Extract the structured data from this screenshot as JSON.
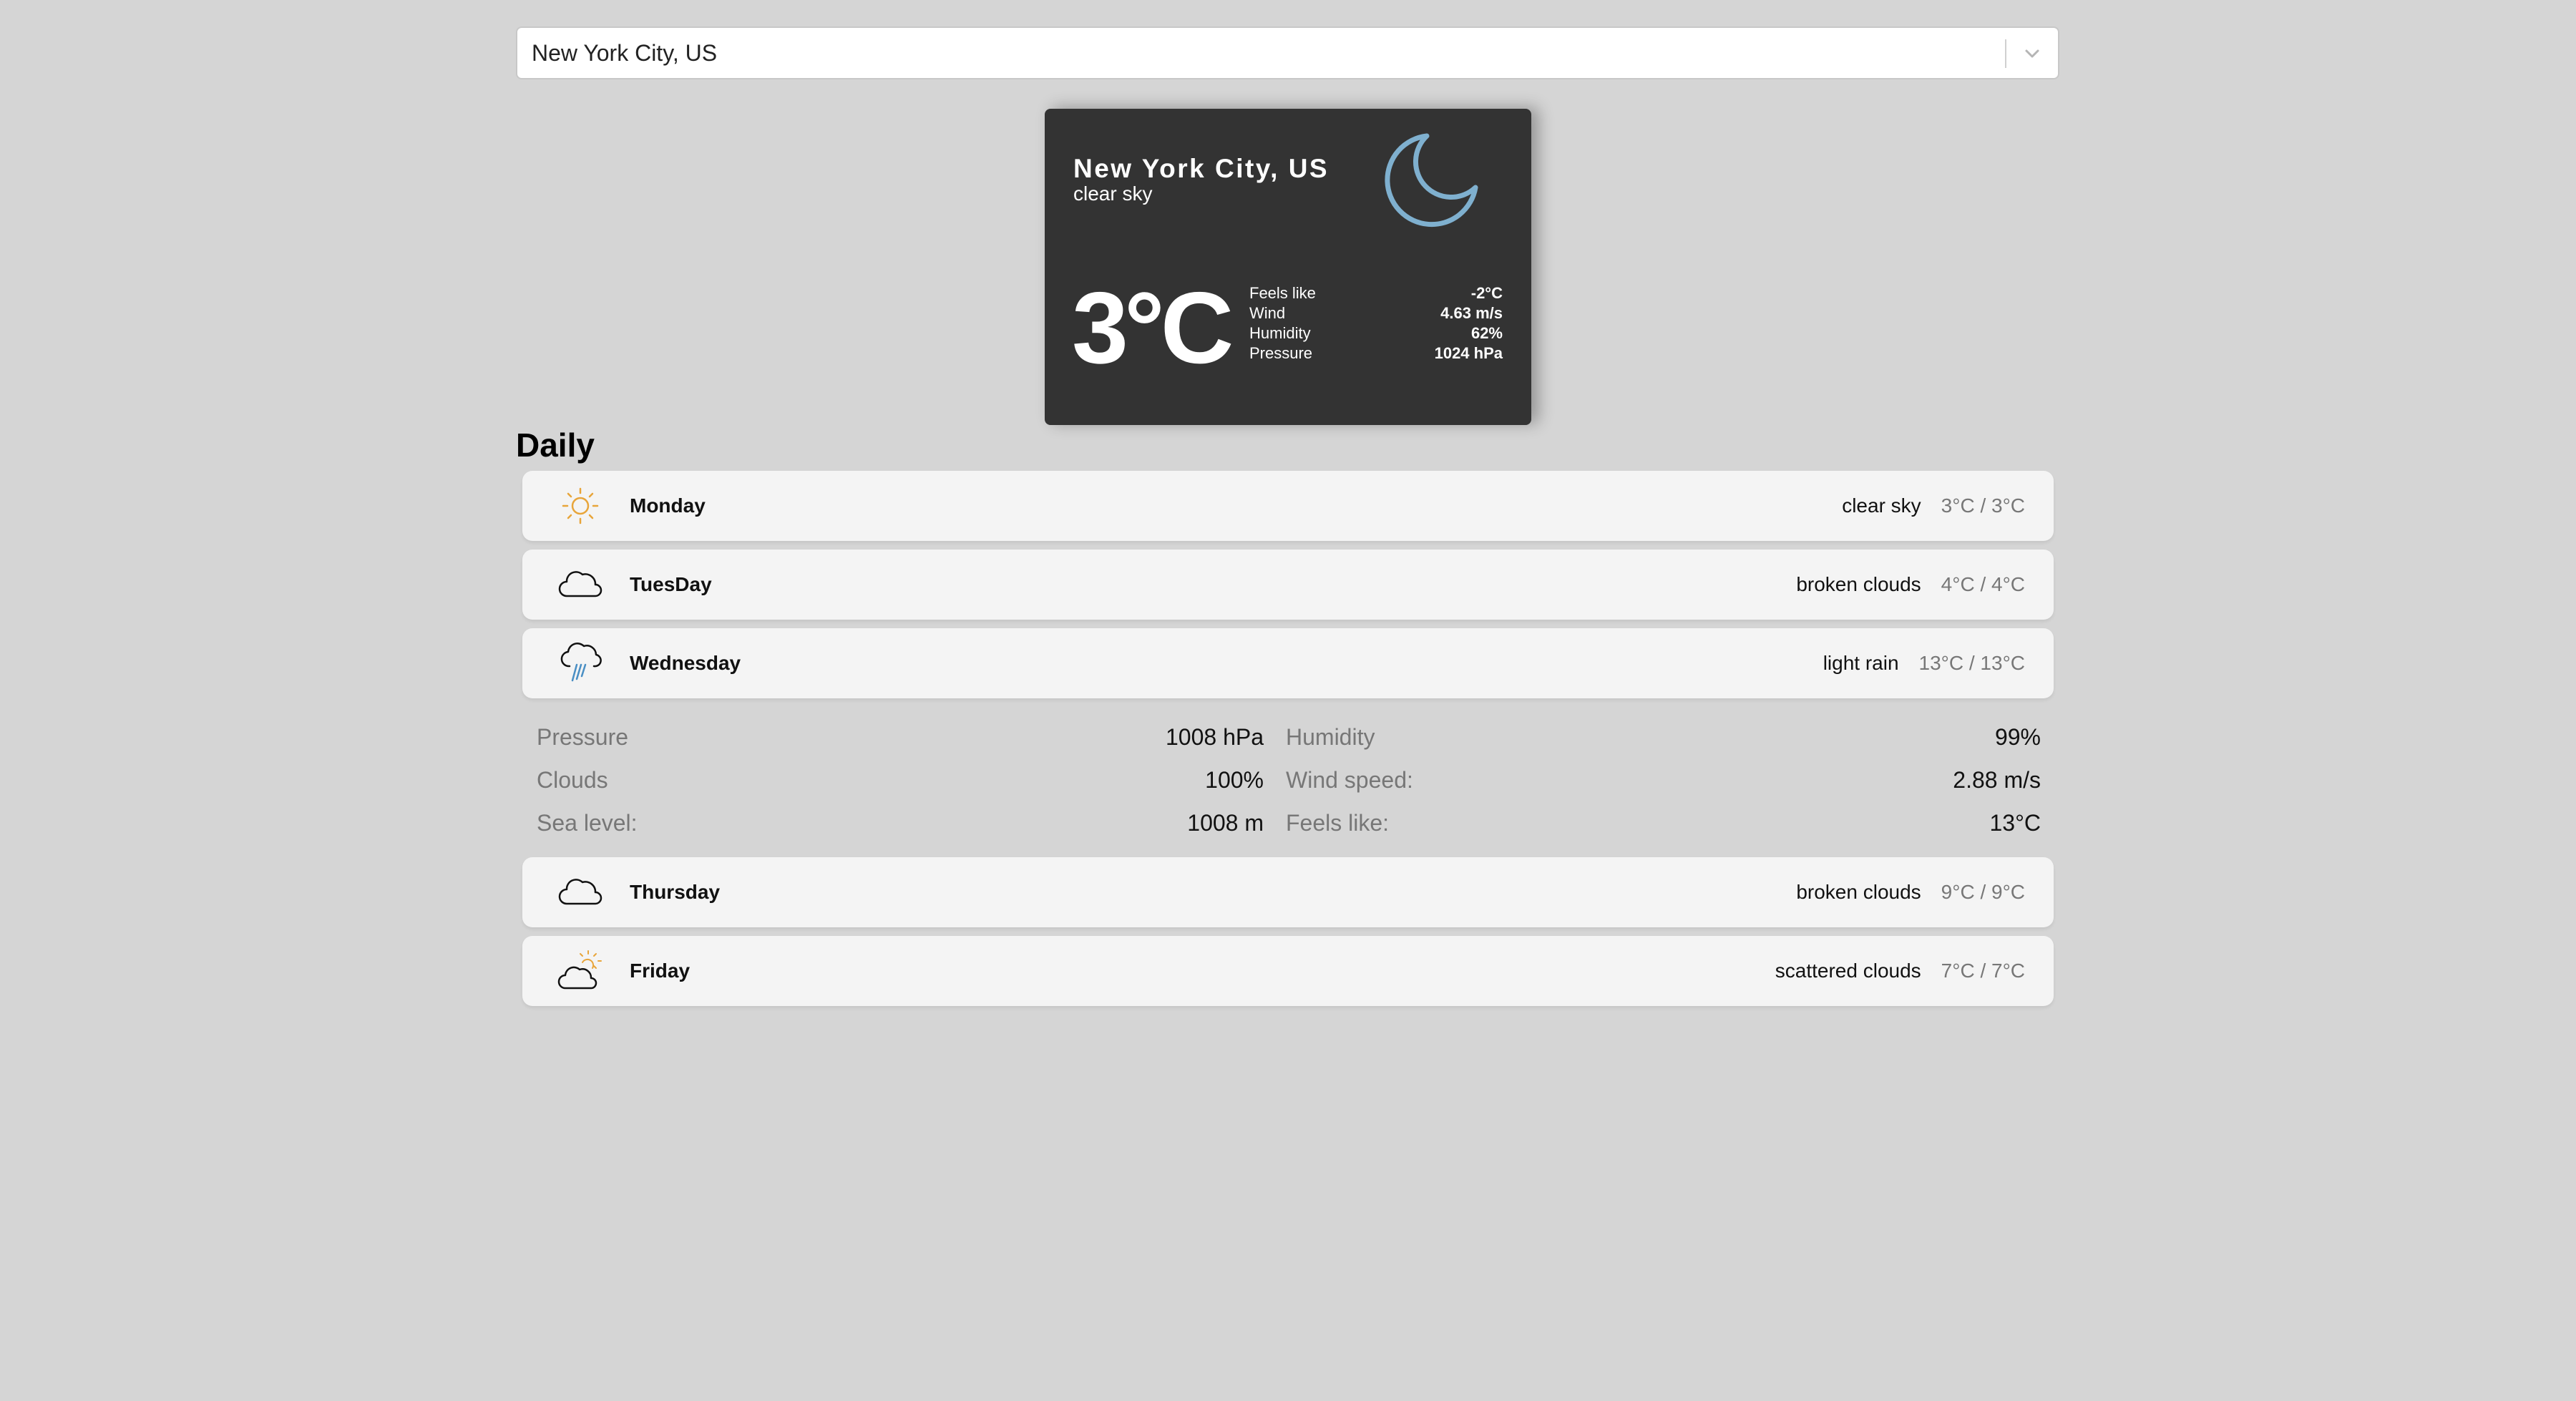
{
  "search": {
    "value": "New York City, US",
    "icon": "chevron-down-icon"
  },
  "current": {
    "city": "New York City, US",
    "description": "clear sky",
    "icon": "moon-icon",
    "icon_color": "#7fb0cf",
    "temperature": "3°C",
    "details": [
      {
        "label": "Feels like",
        "value": "-2°C"
      },
      {
        "label": "Wind",
        "value": "4.63 m/s"
      },
      {
        "label": "Humidity",
        "value": "62%"
      },
      {
        "label": "Pressure",
        "value": "1024 hPa"
      }
    ]
  },
  "daily": {
    "title": "Daily",
    "days": [
      {
        "name": "Monday",
        "description": "clear sky",
        "temps": "3°C / 3°C",
        "icon": "sun-icon"
      },
      {
        "name": "TuesDay",
        "description": "broken clouds",
        "temps": "4°C / 4°C",
        "icon": "cloud-icon"
      },
      {
        "name": "Wednesday",
        "description": "light rain",
        "temps": "13°C / 13°C",
        "icon": "rain-cloud-icon"
      },
      {
        "name": "Thursday",
        "description": "broken clouds",
        "temps": "9°C / 9°C",
        "icon": "cloud-icon"
      },
      {
        "name": "Friday",
        "description": "scattered clouds",
        "temps": "7°C / 7°C",
        "icon": "sun-cloud-icon"
      }
    ],
    "expanded": {
      "rows": [
        [
          {
            "label": "Pressure",
            "value": "1008 hPa"
          },
          {
            "label": "Humidity",
            "value": "99%"
          }
        ],
        [
          {
            "label": "Clouds",
            "value": "100%"
          },
          {
            "label": "Wind speed:",
            "value": "2.88 m/s"
          }
        ],
        [
          {
            "label": "Sea level:",
            "value": "1008 m"
          },
          {
            "label": "Feels like:",
            "value": "13°C"
          }
        ]
      ]
    }
  },
  "colors": {
    "background": "#d5d5d5",
    "card": "#333333",
    "row": "#f4f4f4",
    "sun": "#e8a53a",
    "rain": "#4a8fc4"
  }
}
